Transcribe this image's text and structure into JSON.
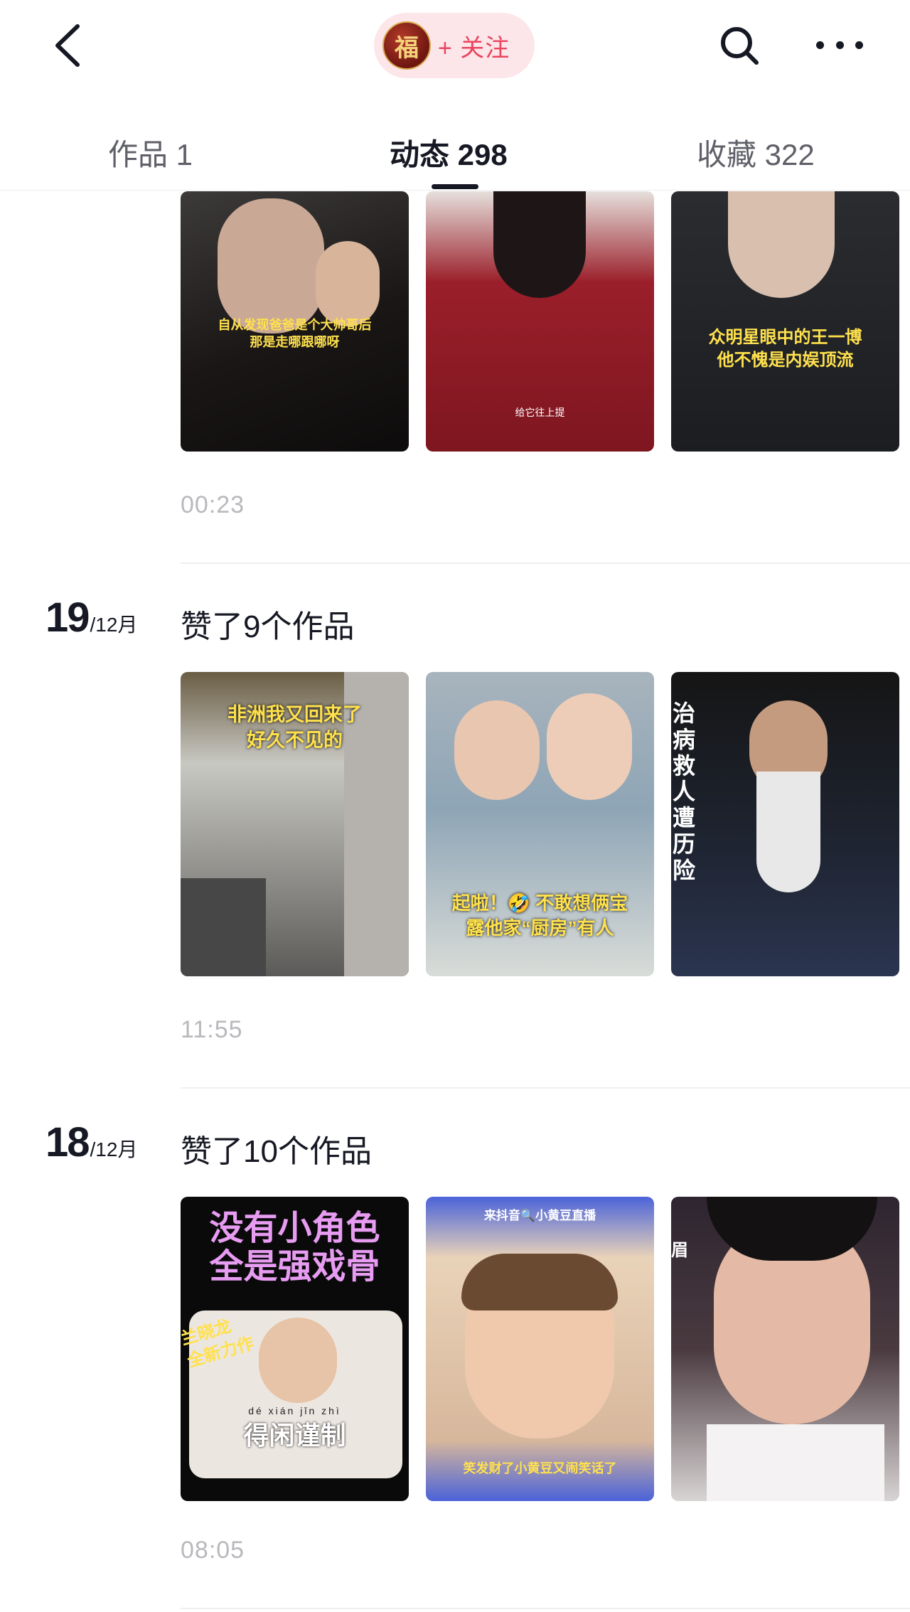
{
  "header": {
    "back_icon": "chevron-left-icon",
    "avatar_text": "福",
    "follow_label": "+ 关注",
    "search_icon": "search-icon",
    "more_icon": "more-dots-icon"
  },
  "tabs": [
    {
      "label": "作品 1",
      "active": false
    },
    {
      "label": "动态 298",
      "active": true
    },
    {
      "label": "收藏 322",
      "active": false
    }
  ],
  "feed": [
    {
      "day": "",
      "month": "",
      "title": "",
      "thumbs": [
        {
          "caption": "自从发现爸爸是个大帅哥后\n那是走哪跟哪呀"
        },
        {
          "caption": "给它往上提"
        },
        {
          "caption": "众明星眼中的王一博\n他不愧是内娱顶流"
        }
      ],
      "time": "00:23"
    },
    {
      "day": "19",
      "month": "/12月",
      "title": "赞了9个作品",
      "thumbs": [
        {
          "caption": "非洲我又回来了\n好久不见的"
        },
        {
          "caption": "起啦！🤣 不敢想俩宝\n露他家“厨房”有人"
        },
        {
          "caption": "治病救人遭历险"
        }
      ],
      "time": "11:55"
    },
    {
      "day": "18",
      "month": "/12月",
      "title": "赞了10个作品",
      "thumbs": [
        {
          "caption": "没有小角色\n全是强戏骨",
          "sub": "兰晓龙\n全新力作",
          "pinyin": "dé xián jǐn zhì",
          "bottom": "得闲谨制"
        },
        {
          "caption": "来抖音🔍小黄豆直播",
          "bottom": "笑发财了小黄豆又闹笑话了"
        },
        {
          "caption": "眉"
        }
      ],
      "time": "08:05"
    }
  ]
}
